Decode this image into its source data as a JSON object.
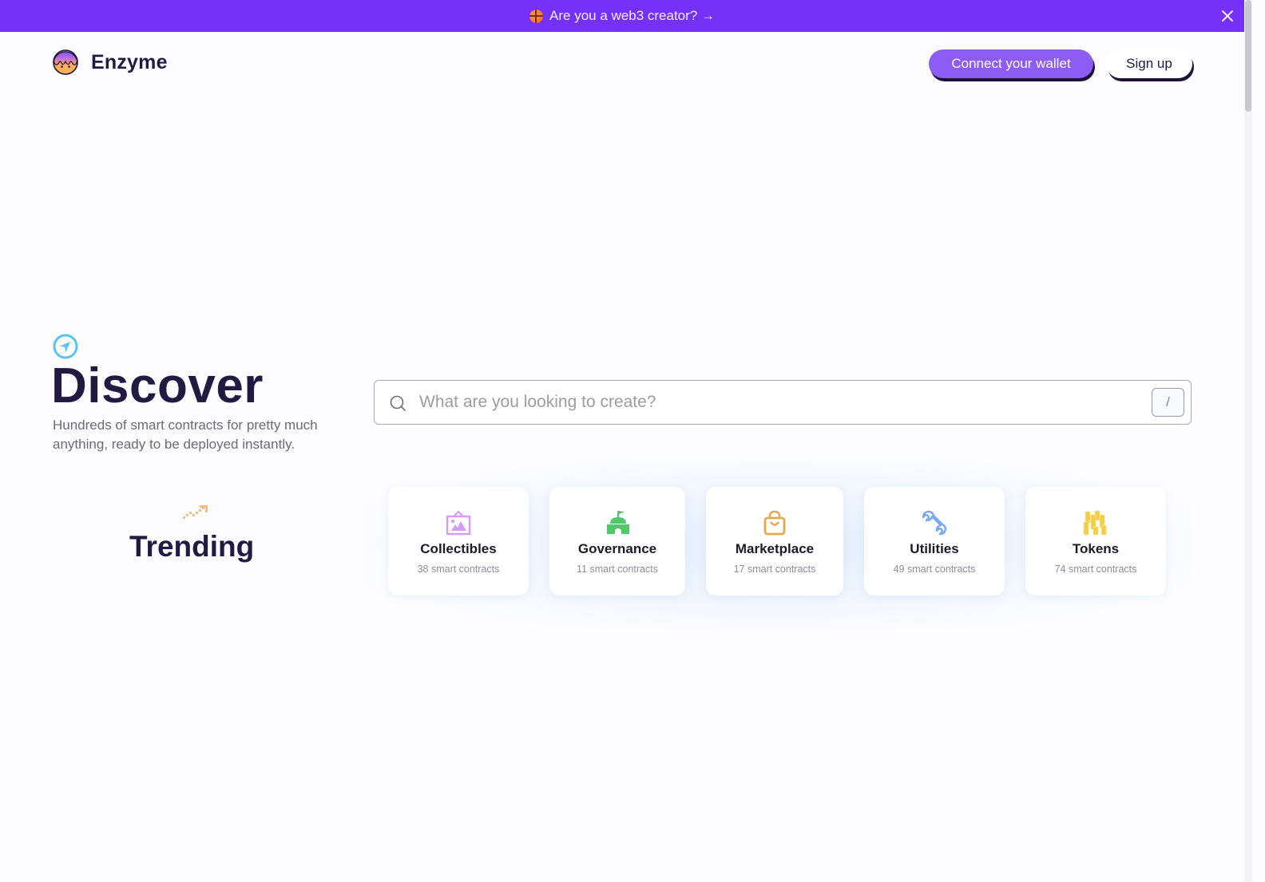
{
  "banner": {
    "text": "Are you a web3 creator? →",
    "emoji_icon": "basketball-icon",
    "close_icon": "close-icon",
    "color": "#7631f9"
  },
  "header": {
    "logo_text": "Enzyme",
    "connect_wallet_label": "Connect your wallet",
    "signup_label": "Sign up"
  },
  "hero": {
    "icon": "compass-icon",
    "title": "Discover",
    "subtitle": "Hundreds of smart contracts for pretty much anything, ready to be deployed instantly."
  },
  "search": {
    "placeholder": "What are you looking to create?",
    "value": "",
    "shortcut_key": "/"
  },
  "trending": {
    "icon": "trending-up-icon",
    "title": "Trending"
  },
  "categories": [
    {
      "icon": "picture-frame-icon",
      "title": "Collectibles",
      "subtitle": "38 smart contracts",
      "color": "#d59cf5"
    },
    {
      "icon": "castle-flag-icon",
      "title": "Governance",
      "subtitle": "11 smart contracts",
      "color": "#4fca6a"
    },
    {
      "icon": "shopping-bag-icon",
      "title": "Marketplace",
      "subtitle": "17 smart contracts",
      "color": "#e3a94a"
    },
    {
      "icon": "wrench-icon",
      "title": "Utilities",
      "subtitle": "49 smart contracts",
      "color": "#7aaaf0"
    },
    {
      "icon": "coin-stacks-icon",
      "title": "Tokens",
      "subtitle": "74 smart contracts",
      "color": "#f3cd45"
    }
  ],
  "colors": {
    "brand_purple": "#8c5cf5",
    "text_dark": "#231a44",
    "accent_blue": "#5cc2f2"
  }
}
